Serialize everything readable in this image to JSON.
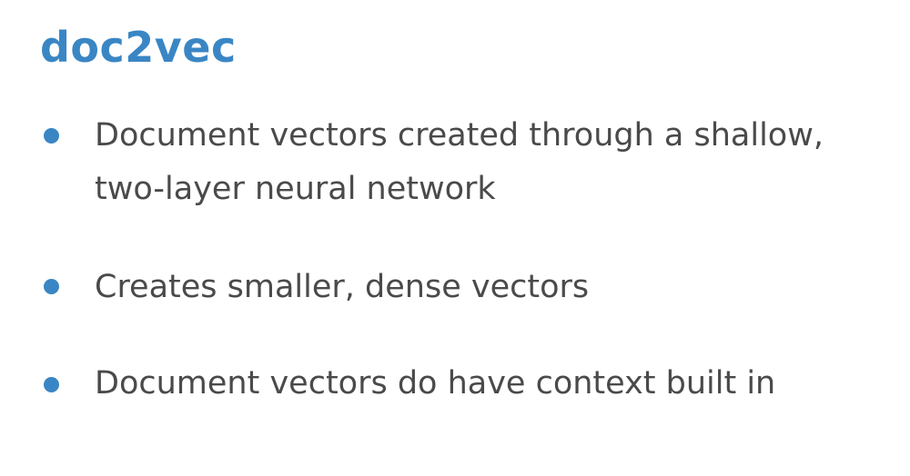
{
  "slide": {
    "title": "doc2vec",
    "bullets": [
      {
        "text": "Document vectors created through a shallow, two-layer neural network"
      },
      {
        "text": "Creates smaller, dense vectors"
      },
      {
        "text": "Document vectors do have context built in"
      }
    ],
    "colors": {
      "accent": "#3a86c4",
      "body_text": "#4a4a4a",
      "background": "#ffffff"
    },
    "icons": {
      "bullet": "bullet-dot-icon"
    }
  }
}
